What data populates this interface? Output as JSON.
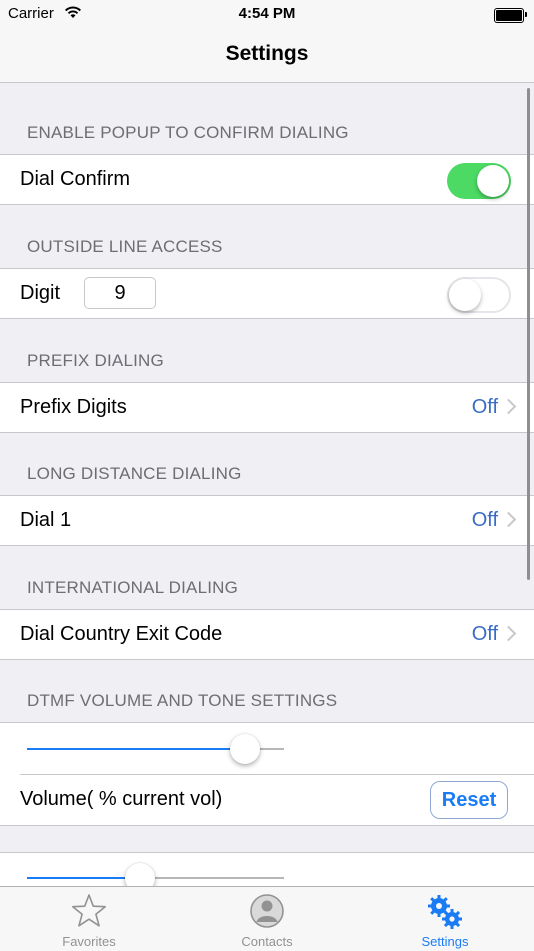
{
  "status_bar": {
    "carrier": "Carrier",
    "time": "4:54 PM",
    "battery_level": 1.0
  },
  "nav": {
    "title": "Settings"
  },
  "sections": {
    "confirm": {
      "header": "ENABLE POPUP TO CONFIRM DIALING",
      "label": "Dial Confirm",
      "toggle_on": true
    },
    "outside": {
      "header": "OUTSIDE LINE ACCESS",
      "label": "Digit",
      "digit": "9",
      "toggle_on": false
    },
    "prefix": {
      "header": "PREFIX DIALING",
      "label": "Prefix Digits",
      "value": "Off"
    },
    "long_distance": {
      "header": "LONG DISTANCE DIALING",
      "label": "Dial 1",
      "value": "Off"
    },
    "international": {
      "header": "INTERNATIONAL DIALING",
      "label": "Dial Country Exit Code",
      "value": "Off"
    },
    "dtmf": {
      "header": "DTMF VOLUME AND TONE SETTINGS",
      "volume_slider": 0.85,
      "volume_label": "Volume( % current vol)",
      "reset_label": "Reset",
      "second_slider": 0.44
    }
  },
  "tabs": [
    {
      "label": "Favorites",
      "icon": "star-icon",
      "active": false
    },
    {
      "label": "Contacts",
      "icon": "contact-icon",
      "active": false
    },
    {
      "label": "Settings",
      "icon": "gears-icon",
      "active": true
    }
  ],
  "colors": {
    "accent": "#1a7cf5",
    "switch_on": "#4cd964",
    "value_text": "#3a6cc5"
  }
}
